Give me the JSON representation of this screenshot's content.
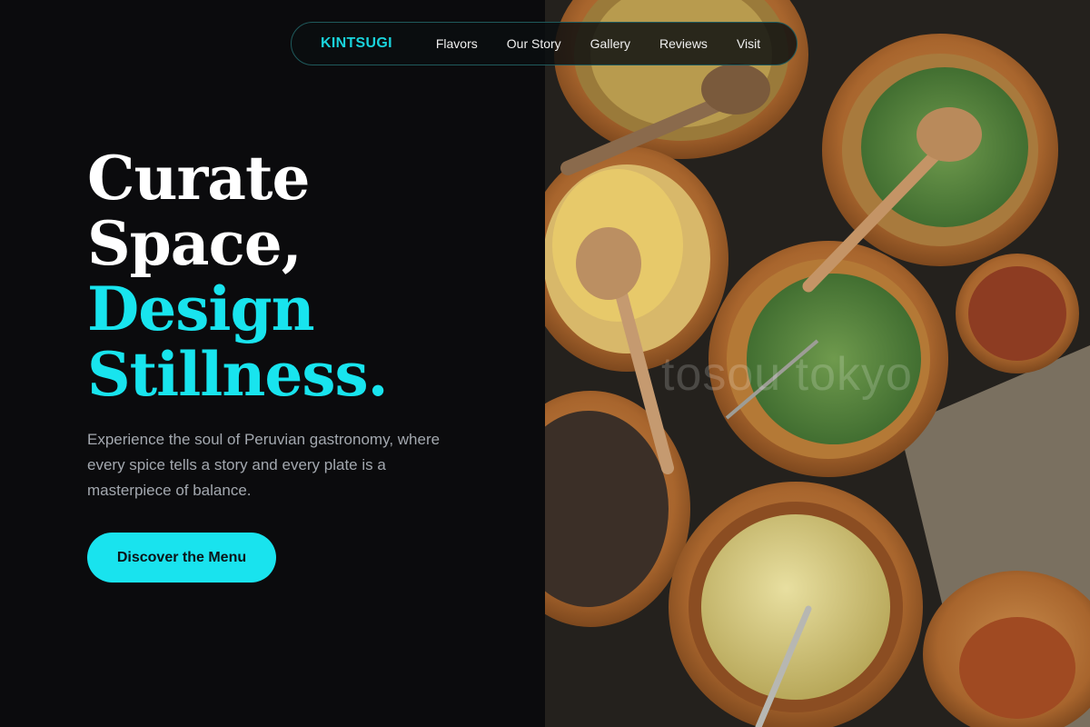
{
  "nav": {
    "brand": "KINTSUGI",
    "links": [
      "Flavors",
      "Our Story",
      "Gallery",
      "Reviews",
      "Visit"
    ]
  },
  "hero": {
    "title_lines": [
      "Curate",
      "Space,",
      "Design",
      "Stillness."
    ],
    "subtitle": "Experience the soul of Peruvian gastronomy, where every spice tells a story and every plate is a masterpiece of balance.",
    "cta_label": "Discover the Menu"
  },
  "photo": {
    "watermark": "tosou tokyo",
    "description_icon": "food-bowls-photo"
  },
  "colors": {
    "accent": "#18e4ee",
    "background": "#0b0b0d",
    "text_primary": "#ffffff",
    "text_muted": "#a3a8af"
  }
}
